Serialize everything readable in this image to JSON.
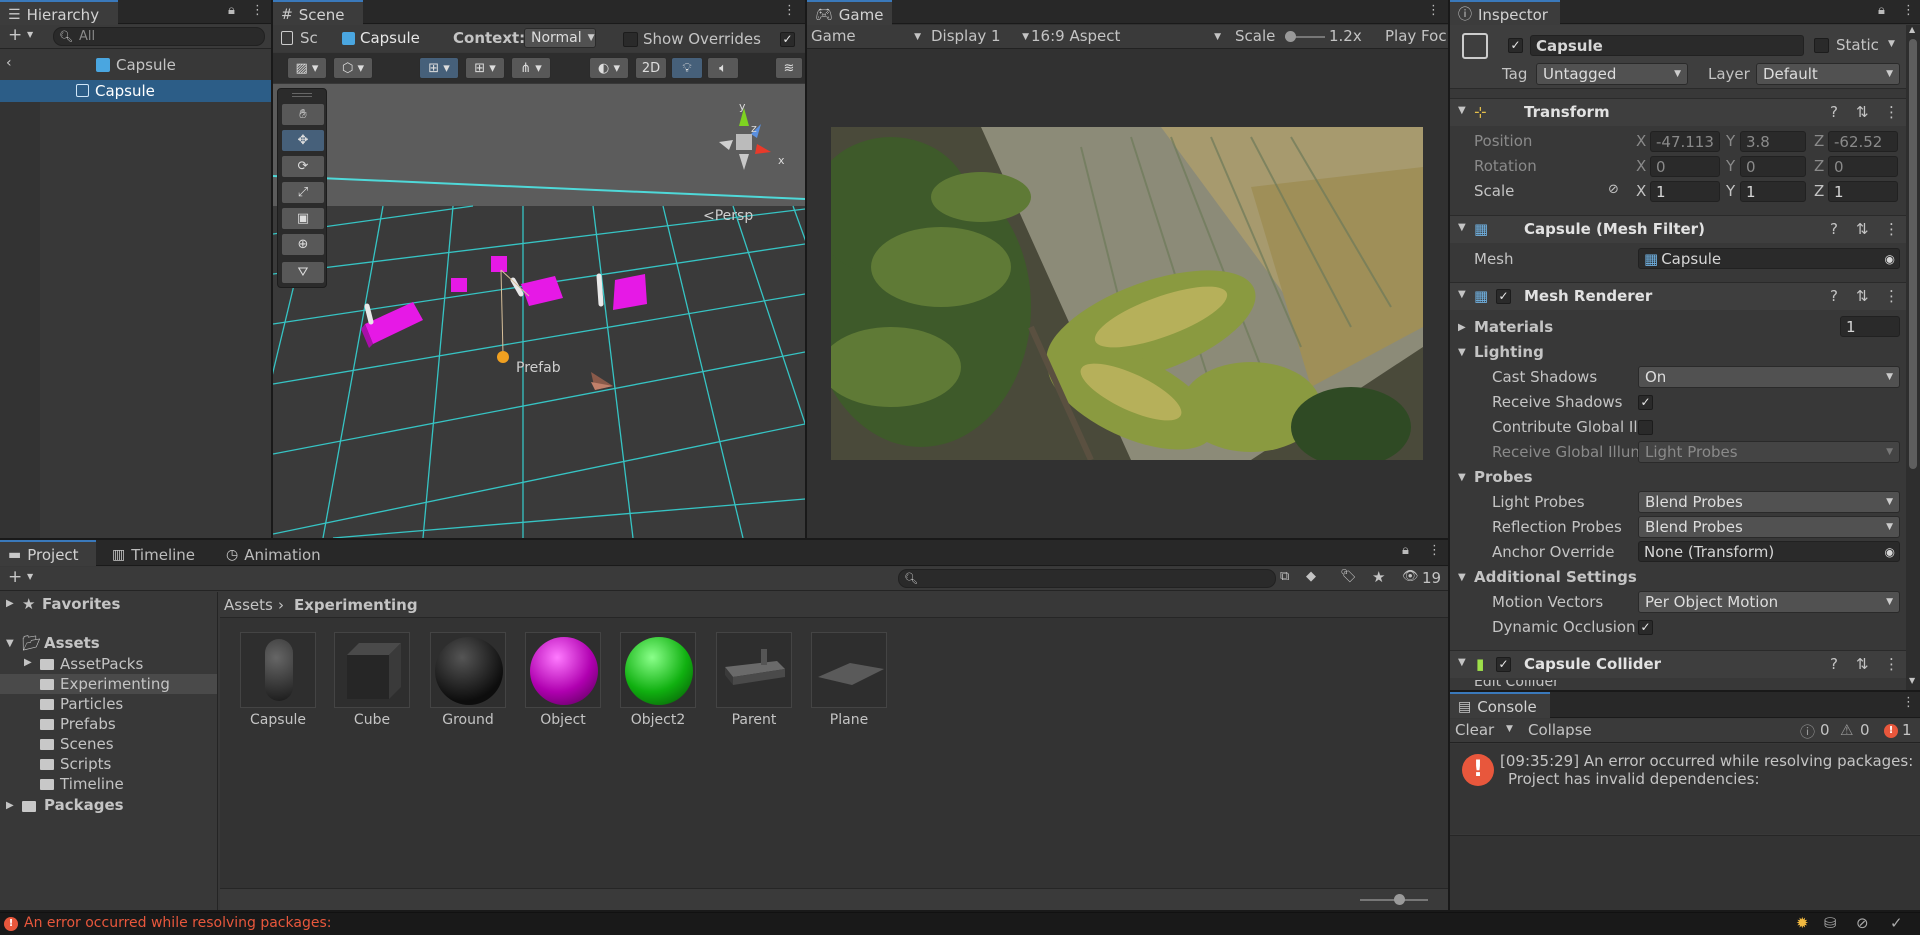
{
  "hierarchy": {
    "tab": "Hierarchy",
    "search_placeholder": "All",
    "scene_name": "Capsule",
    "selected_object": "Capsule"
  },
  "scene": {
    "tab": "Scene",
    "breadcrumb_root": "Sc",
    "breadcrumb_prefab": "Capsule",
    "context_label": "Context:",
    "context_value": "Normal",
    "show_overrides": "Show Overrides",
    "btn_2d": "2D",
    "persp": "<Persp",
    "prefab_label": "Prefab",
    "gizmo_y": "y",
    "gizmo_z": "z",
    "gizmo_x": "x"
  },
  "game": {
    "tab": "Game",
    "mode": "Game",
    "display": "Display 1",
    "aspect": "16:9 Aspect",
    "scale_label": "Scale",
    "scale_value": "1.2x",
    "play_focus": "Play Foc"
  },
  "inspector": {
    "tab": "Inspector",
    "object_name": "Capsule",
    "static_label": "Static",
    "tag_label": "Tag",
    "tag_value": "Untagged",
    "layer_label": "Layer",
    "layer_value": "Default",
    "transform": {
      "title": "Transform",
      "position_label": "Position",
      "rotation_label": "Rotation",
      "scale_label": "Scale",
      "pos": {
        "x": "-47.113",
        "y": "3.8",
        "z": "-62.52"
      },
      "rot": {
        "x": "0",
        "y": "0",
        "z": "0"
      },
      "scl": {
        "x": "1",
        "y": "1",
        "z": "1"
      },
      "x": "X",
      "y": "Y",
      "z": "Z"
    },
    "mesh_filter": {
      "title": "Capsule (Mesh Filter)",
      "mesh_label": "Mesh",
      "mesh_value": "Capsule"
    },
    "mesh_renderer": {
      "title": "Mesh Renderer",
      "materials_label": "Materials",
      "materials_count": "1",
      "lighting": "Lighting",
      "cast_shadows_label": "Cast Shadows",
      "cast_shadows_value": "On",
      "receive_shadows_label": "Receive Shadows",
      "contribute_gi_label": "Contribute Global Ill",
      "receive_gi_label": "Receive Global Illun",
      "receive_gi_value": "Light Probes",
      "probes": "Probes",
      "light_probes_label": "Light Probes",
      "light_probes_value": "Blend Probes",
      "reflection_probes_label": "Reflection Probes",
      "reflection_probes_value": "Blend Probes",
      "anchor_override_label": "Anchor Override",
      "anchor_override_value": "None (Transform)",
      "additional": "Additional Settings",
      "motion_vectors_label": "Motion Vectors",
      "motion_vectors_value": "Per Object Motion",
      "dynamic_occlusion_label": "Dynamic Occlusion"
    },
    "capsule_collider": {
      "title": "Capsule Collider",
      "edit_label": "Edit Collider"
    }
  },
  "project": {
    "tabs": [
      "Project",
      "Timeline",
      "Animation"
    ],
    "hidden_count": "19",
    "tree": {
      "favorites": "Favorites",
      "assets": "Assets",
      "children": [
        "AssetPacks",
        "Experimenting",
        "Particles",
        "Prefabs",
        "Scenes",
        "Scripts",
        "Timeline"
      ],
      "packages": "Packages"
    },
    "breadcrumb": [
      "Assets",
      "Experimenting"
    ],
    "assets": [
      {
        "name": "Capsule",
        "kind": "capsule"
      },
      {
        "name": "Cube",
        "kind": "cube"
      },
      {
        "name": "Ground",
        "kind": "sphere-black"
      },
      {
        "name": "Object",
        "kind": "sphere-magenta"
      },
      {
        "name": "Object2",
        "kind": "sphere-green"
      },
      {
        "name": "Parent",
        "kind": "prefab"
      },
      {
        "name": "Plane",
        "kind": "plane"
      }
    ]
  },
  "console": {
    "tab": "Console",
    "clear": "Clear",
    "collapse": "Collapse",
    "info_count": "0",
    "warn_count": "0",
    "error_count": "1",
    "message_line1": "[09:35:29] An error occurred while resolving packages:",
    "message_line2": "Project has invalid dependencies:"
  },
  "status": {
    "message": "An error occurred while resolving packages:"
  },
  "colors": {
    "accent": "#3a79bb",
    "error": "#e8573c",
    "selection": "#2c5d87",
    "magenta": "#e619e6",
    "grid": "#3cd2d2"
  }
}
